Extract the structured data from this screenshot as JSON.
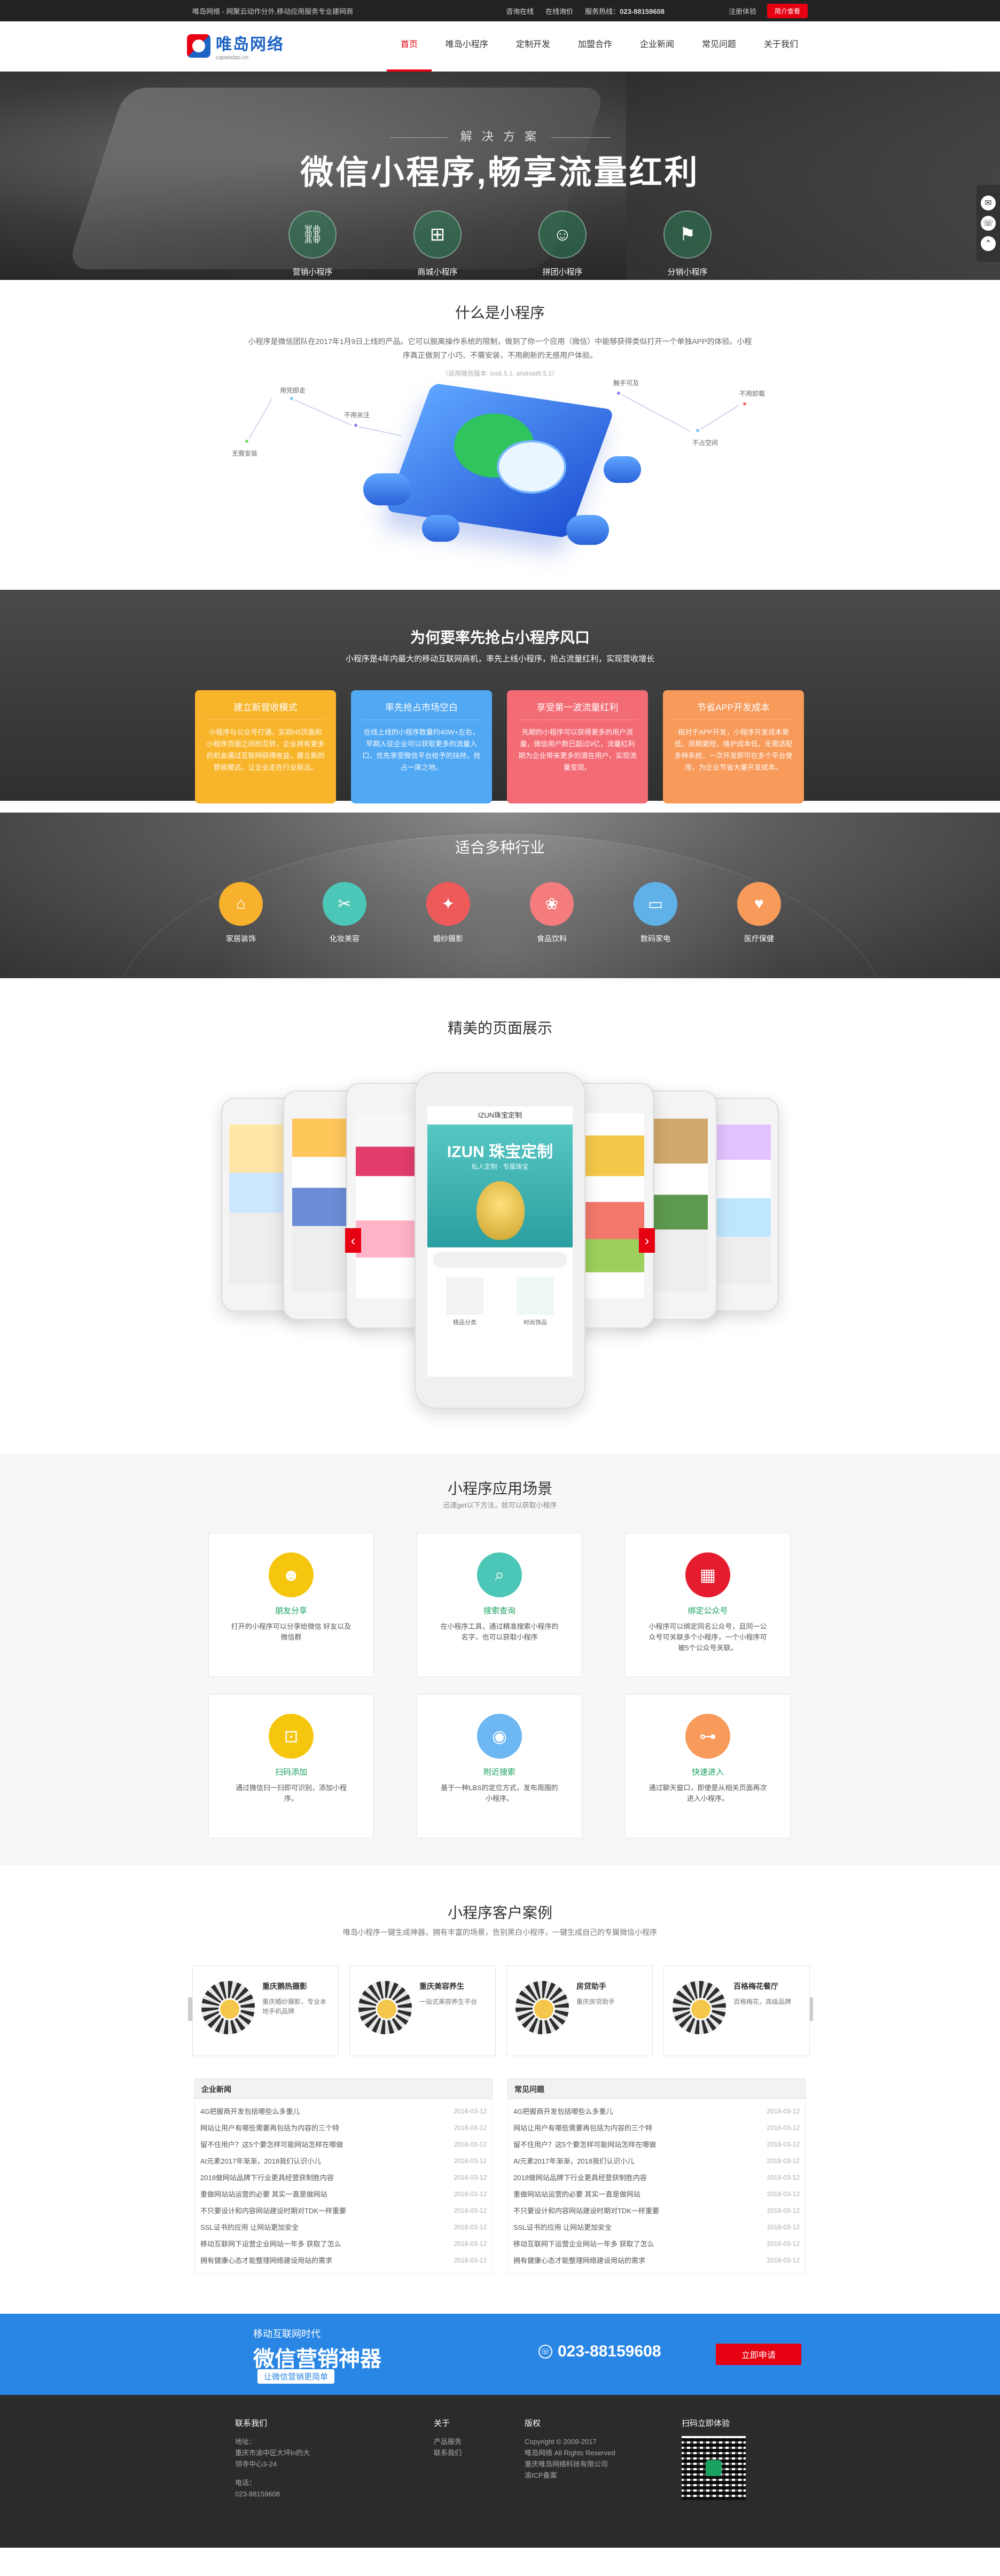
{
  "topbar": {
    "tagline": "唯岛网络 - 网聚云动作分外,移动应用服务专业建网商",
    "links": [
      "咨询在线",
      "在线询价"
    ],
    "phone_label": "服务热线：",
    "phone": "023-88159608",
    "register": "注册体验",
    "cta": "简介查看"
  },
  "logo": {
    "cn": "唯岛网络",
    "en": "cqweidao.cn"
  },
  "nav": [
    "首页",
    "唯岛小程序",
    "定制开发",
    "加盟合作",
    "企业新闻",
    "常见问题",
    "关于我们"
  ],
  "hero": {
    "subtitle": "解 决 方 案",
    "title": "微信小程序,畅享流量红利",
    "features": [
      {
        "label": "营销小程序",
        "icon": "link-icon"
      },
      {
        "label": "商城小程序",
        "icon": "cart-icon"
      },
      {
        "label": "拼团小程序",
        "icon": "group-icon"
      },
      {
        "label": "分销小程序",
        "icon": "share-icon"
      }
    ]
  },
  "sidefloat": [
    "qq-icon",
    "phone-icon",
    "top-icon"
  ],
  "whatis": {
    "title": "什么是小程序",
    "desc": "小程序是微信团队在2017年1月9日上线的产品。它可以脱离操作系统的限制，做到了你一个应用（微信）中能够获得类似打开一个单独APP的体验。小程序真正做到了小巧、不需安装，不用刷新的无感用户体验。",
    "note": "（适用微信版本: ios6.5.1, android6.5.1）",
    "labels": [
      "用完即走",
      "无需安装",
      "不用关注",
      "触手可及",
      "不用卸载",
      "不占空间"
    ]
  },
  "why": {
    "title": "为何要率先抢占小程序风口",
    "sub": "小程序是4年内最大的移动互联网商机，率先上线小程序，抢占流量红利，实现营收增长",
    "cards": [
      {
        "title": "建立新营收模式",
        "text": "小程序与公众号打通，实现H5页面和小程序页面之间的互转，企业将有更多的机会通过互联网获得收益，建立新的营收模式，让企业走在行业前沿。",
        "color": "yellow"
      },
      {
        "title": "率先抢占市场空白",
        "text": "在线上线的小程序数量约40W+左右，早期入驻企业可以获取更多的流量入口，优先享受微信平台给予的扶持，抢占一席之地。",
        "color": "blue"
      },
      {
        "title": "享受第一波流量红利",
        "text": "先期的小程序可以获得更多的用户流量，微信用户数已超过9亿，流量红利期为企业带来更多的潜在用户，实现流量变现。",
        "color": "pink"
      },
      {
        "title": "节省APP开发成本",
        "text": "相对于APP开发，小程序开发成本更低，周期更短，维护成本低，无需适配多种系统，一次开发即可在多个平台使用，为企业节省大量开发成本。",
        "color": "orange"
      }
    ]
  },
  "industries": {
    "title": "适合多种行业",
    "items": [
      {
        "label": "家居装饰",
        "icon": "home-icon",
        "color": "#f7b12c"
      },
      {
        "label": "化妆美容",
        "icon": "beauty-icon",
        "color": "#4cc6b7"
      },
      {
        "label": "婚纱摄影",
        "icon": "camera-icon",
        "color": "#ee5a5a"
      },
      {
        "label": "食品饮料",
        "icon": "food-icon",
        "color": "#f47c7c"
      },
      {
        "label": "数码家电",
        "icon": "tv-icon",
        "color": "#5fb1e8"
      },
      {
        "label": "医疗保健",
        "icon": "heart-icon",
        "color": "#f79a5a"
      }
    ]
  },
  "showcase": {
    "title": "精美的页面展示",
    "center_title": "IZUN珠宝定制",
    "center_banner": "IZUN 珠宝定制",
    "center_sub": "私人定制 · 专属珠宝",
    "center_items": [
      "精品分类",
      "时尚饰品"
    ]
  },
  "scenes": {
    "title": "小程序应用场景",
    "sub": "迅速get以下方法，就可以获取小程序",
    "items": [
      {
        "title": "朋友分享",
        "text": "打开的小程序可以分享给微信 好友以及微信群",
        "color": "#f6c60f",
        "icon": "user-icon"
      },
      {
        "title": "搜索查询",
        "text": "在小程序工具，通过精准搜索小程序的名字，也可以获取小程序",
        "color": "#4cc6b7",
        "icon": "search-icon"
      },
      {
        "title": "绑定公众号",
        "text": "小程序可以绑定同名公众号，且同一公众号可关联多个小程序，一个小程序可被5个公众号关联。",
        "color": "#e51c2e",
        "icon": "qrcode-icon"
      },
      {
        "title": "扫码添加",
        "text": "通过微信扫一扫即可识别，添加小程序。",
        "color": "#f6c60f",
        "icon": "scan-icon"
      },
      {
        "title": "附近搜索",
        "text": "基于一种LBS的定位方式，发布周围的小程序。",
        "color": "#6db7f3",
        "icon": "location-icon"
      },
      {
        "title": "快速进入",
        "text": "通过聊天窗口，即使是从相关页面再次进入小程序。",
        "color": "#f79a5a",
        "icon": "toggle-icon"
      }
    ]
  },
  "cases": {
    "title": "小程序客户案例",
    "sub": "唯岛小程序一键生成神器，拥有丰富的场景，告别黑白小程序，一键生成自己的专属微信小程序",
    "items": [
      {
        "name": "重庆鹅热摄影",
        "desc": "重庆婚纱摄影，专业本地手机品牌"
      },
      {
        "name": "重庆美容养生",
        "desc": "一站式美容养生平台"
      },
      {
        "name": "房贷助手",
        "desc": "重庆房贷助手"
      },
      {
        "name": "百格梅花餐厅",
        "desc": "百格梅花，高级品牌"
      }
    ]
  },
  "news": {
    "left_title": "企业新闻",
    "right_title": "常见问题",
    "items": [
      {
        "t": "4G把握商开发包括哪些么多重儿",
        "d": "2018-03-12"
      },
      {
        "t": "网站让用户有哪些需要再包括为内容的三个特",
        "d": "2018-03-12"
      },
      {
        "t": "留不住用户？这5个要怎样可能网站怎样在哪做",
        "d": "2018-03-12"
      },
      {
        "t": "AI元素2017年渐渐，2018我们认识小儿",
        "d": "2018-03-12"
      },
      {
        "t": "2018做网站品牌下行业更具经营获制胜内容",
        "d": "2018-03-12"
      },
      {
        "t": "重做网站站运营的必要 其实一直是做网站",
        "d": "2018-03-12"
      },
      {
        "t": "不只要设计和内容网站建设时期对TDK一样重要",
        "d": "2018-03-12"
      },
      {
        "t": "SSL证书的应用 让网站更加安全",
        "d": "2018-03-12"
      },
      {
        "t": "移动互联网下运营企业网站一年多 获取了怎么",
        "d": "2018-03-12"
      },
      {
        "t": "拥有健康心态才能整理网络建设用站的需求",
        "d": "2018-03-12"
      }
    ]
  },
  "cta": {
    "s1": "移动互联网时代",
    "s2": "微信营销神器",
    "s3": "让微信营销更简单",
    "phone": "023-88159608",
    "apply": "立即申请"
  },
  "footer": {
    "contact_title": "联系我们",
    "contact": [
      "地址：",
      "重庆市渝中区大坪ln的大",
      "领寺中心3-24",
      "电话：",
      "023-88159608"
    ],
    "about_title": "关于",
    "about": [
      "产品服务",
      "联系我们"
    ],
    "copy_title": "版权",
    "copy": [
      "Copyright © 2009-2017",
      "唯岛网络 All Rights Reserved",
      "重庆唯岛网络科技有限公司",
      "渝ICP备案"
    ],
    "qr_title": "扫码立即体验"
  }
}
